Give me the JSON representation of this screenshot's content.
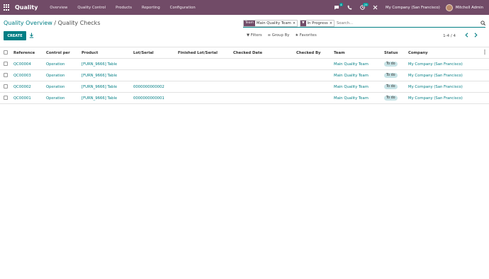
{
  "navbar": {
    "app_name": "Quality",
    "menu": [
      "Overview",
      "Quality Control",
      "Products",
      "Reporting",
      "Configuration"
    ],
    "chat_badge": "4",
    "activity_badge": "25",
    "company": "My Company (San Francisco)",
    "user": "Mitchell Admin"
  },
  "breadcrumb": {
    "parent": "Quality Overview",
    "separator": " / ",
    "current": "Quality Checks"
  },
  "search": {
    "facets": [
      {
        "label": "Team",
        "value": "Main Quality Team",
        "remove": "×"
      },
      {
        "label": "▼",
        "value": "In Progress",
        "remove": "×"
      }
    ],
    "placeholder": "Search..."
  },
  "toolbar": {
    "create_label": "CREATE",
    "filters_label": "▼ Filters",
    "groupby_label": "≡ Group By",
    "favorites_label": "★ Favorites",
    "pager": "1-4 / 4"
  },
  "table": {
    "columns": [
      "Reference",
      "Control per",
      "Product",
      "Lot/Serial",
      "Finished Lot/Serial",
      "Checked Date",
      "Checked By",
      "Team",
      "Status",
      "Company"
    ],
    "rows": [
      {
        "reference": "QC00004",
        "control_per": "Operation",
        "product": "[FURN_9666] Table",
        "lot": "",
        "finished_lot": "",
        "checked_date": "",
        "checked_by": "",
        "team": "Main Quality Team",
        "status": "To do",
        "company": "My Company (San Francisco)"
      },
      {
        "reference": "QC00003",
        "control_per": "Operation",
        "product": "[FURN_9666] Table",
        "lot": "",
        "finished_lot": "",
        "checked_date": "",
        "checked_by": "",
        "team": "Main Quality Team",
        "status": "To do",
        "company": "My Company (San Francisco)"
      },
      {
        "reference": "QC00002",
        "control_per": "Operation",
        "product": "[FURN_9666] Table",
        "lot": "0000000000002",
        "finished_lot": "",
        "checked_date": "",
        "checked_by": "",
        "team": "Main Quality Team",
        "status": "To do",
        "company": "My Company (San Francisco)"
      },
      {
        "reference": "QC00001",
        "control_per": "Operation",
        "product": "[FURN_9666] Table",
        "lot": "0000000000001",
        "finished_lot": "",
        "checked_date": "",
        "checked_by": "",
        "team": "Main Quality Team",
        "status": "To do",
        "company": "My Company (San Francisco)"
      }
    ]
  },
  "colors": {
    "brand": "#714b67",
    "accent": "#017e84",
    "status_bg": "#c7e3e6"
  }
}
